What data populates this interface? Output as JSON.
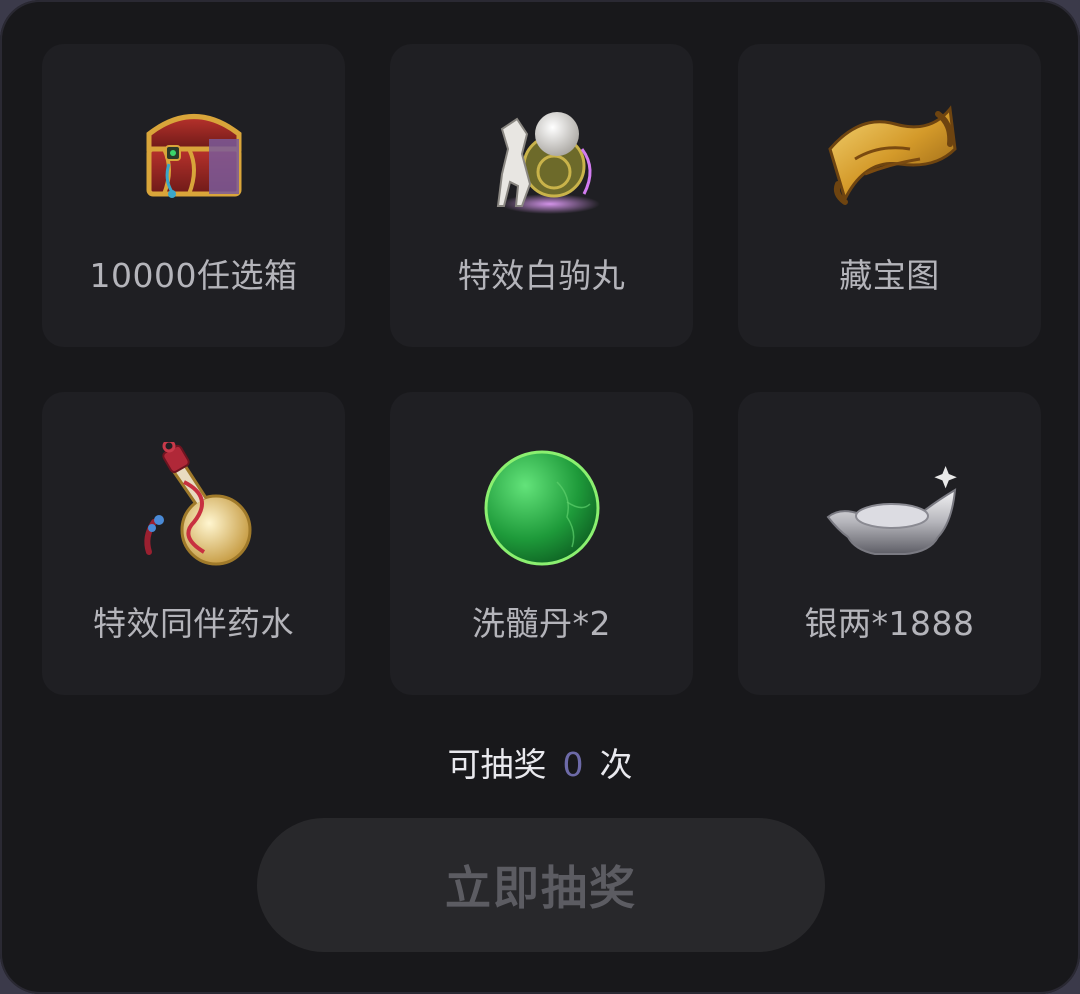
{
  "prizes": [
    {
      "label": "10000任选箱",
      "icon": "treasure-chest-icon"
    },
    {
      "label": "特效白驹丸",
      "icon": "white-horse-pill-icon"
    },
    {
      "label": "藏宝图",
      "icon": "treasure-map-icon"
    },
    {
      "label": "特效同伴药水",
      "icon": "companion-potion-icon"
    },
    {
      "label": "洗髓丹*2",
      "icon": "green-pill-icon"
    },
    {
      "label": "银两*1888",
      "icon": "silver-ingot-icon"
    }
  ],
  "draw_info": {
    "prefix": "可抽奖",
    "count": "0",
    "suffix": "次"
  },
  "draw_button": {
    "label": "立即抽奖"
  },
  "colors": {
    "panel_bg": "#18181b",
    "cell_bg": "#1f1f23",
    "count_accent": "#6d6aa8",
    "button_bg": "#28282b",
    "button_text": "#5c5c62"
  }
}
